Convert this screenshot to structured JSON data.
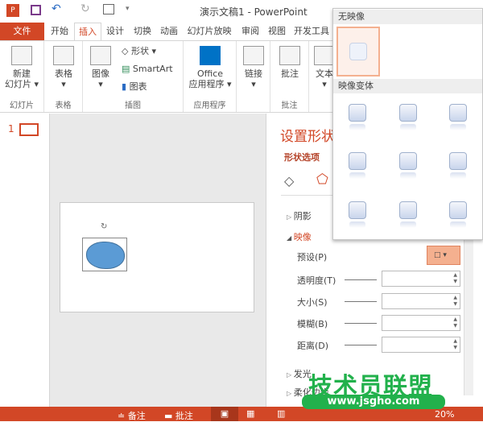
{
  "titlebar": {
    "title": "演示文稿1 - PowerPoint"
  },
  "tabs": [
    "文件",
    "开始",
    "插入",
    "设计",
    "切换",
    "动画",
    "幻灯片放映",
    "审阅",
    "视图",
    "开发工具"
  ],
  "ribbon": {
    "new_slide": "新建\n幻灯片 ▾",
    "group_slides": "幻灯片",
    "table": "表格\n▾",
    "group_table": "表格",
    "images": "图像\n▾",
    "shapes": "形状 ▾",
    "smartart": "SmartArt",
    "chart": "图表",
    "group_illustrations": "插图",
    "office_apps": "Office\n应用程序 ▾",
    "group_apps": "应用程序",
    "links": "链接\n▾",
    "comment": "批注",
    "group_comments": "批注",
    "text": "文本\n▾"
  },
  "thumbs": {
    "number": "1"
  },
  "pane": {
    "title": "设置形状格式",
    "tab": "形状选项",
    "sections": {
      "shadow": "阴影",
      "reflection": "映像",
      "glow": "发光",
      "soft_edges": "柔化边缘"
    },
    "fields": {
      "preset": "预设(P)",
      "transparency": "透明度(T)",
      "size": "大小(S)",
      "blur": "模糊(B)",
      "distance": "距离(D)"
    }
  },
  "dropdown": {
    "no_reflection": "无映像",
    "variations": "映像变体"
  },
  "status": {
    "notes": "备注",
    "comments": "批注",
    "zoom": "20%"
  },
  "watermark": {
    "brand": "技术员联盟",
    "url": "www.jsgho.com"
  },
  "colors": {
    "accent": "#d24726",
    "shape": "#5b9bd5"
  }
}
